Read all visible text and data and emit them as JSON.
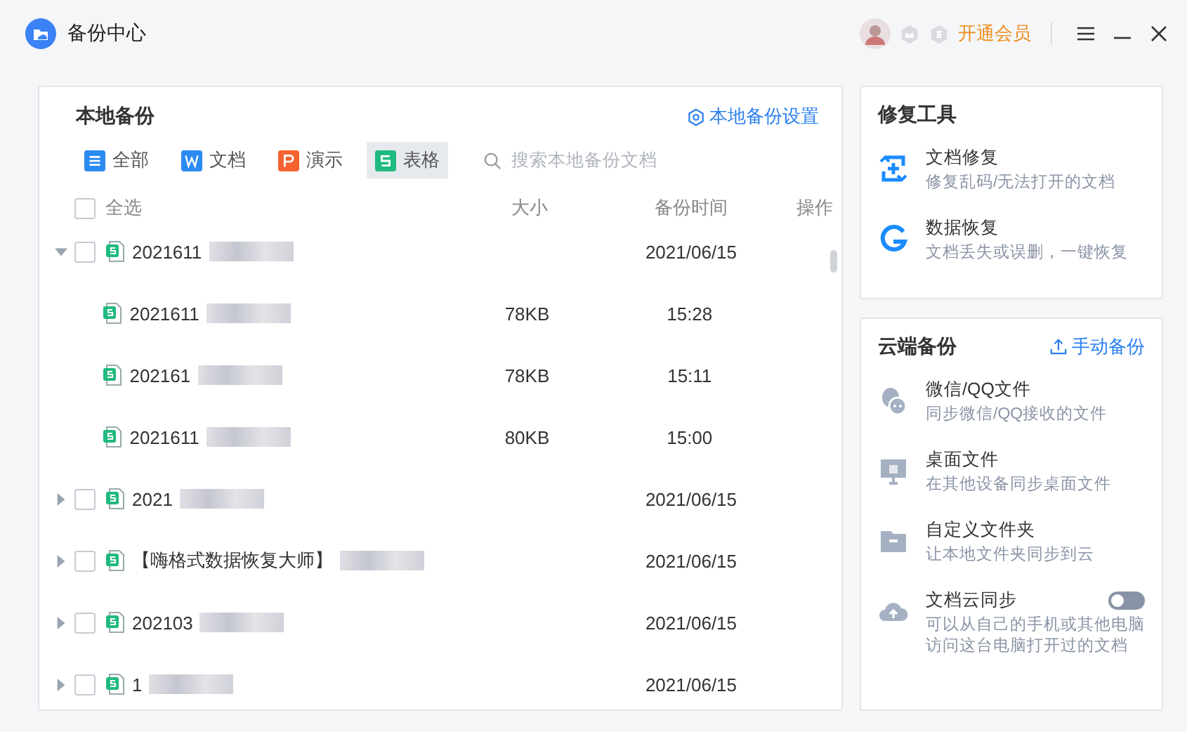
{
  "window": {
    "title": "备份中心",
    "vip_link": "开通会员"
  },
  "local_backup": {
    "title": "本地备份",
    "settings_link": "本地备份设置",
    "filters": [
      {
        "label": "全部",
        "kind": "all",
        "selected": false
      },
      {
        "label": "文档",
        "kind": "doc",
        "selected": false
      },
      {
        "label": "演示",
        "kind": "ppt",
        "selected": false
      },
      {
        "label": "表格",
        "kind": "sheet",
        "selected": true
      }
    ],
    "search": {
      "placeholder": "搜索本地备份文档"
    },
    "table": {
      "select_all": {
        "label": "全选",
        "checked": false
      },
      "columns": [
        "大小",
        "备份时间",
        "操作"
      ],
      "rows": [
        {
          "name": "2021611",
          "expanded": true,
          "checked": false,
          "time": "2021/06/15",
          "children": [
            {
              "name": "2021611",
              "size": "78KB",
              "time": "15:28"
            },
            {
              "name": "202161",
              "size": "78KB",
              "time": "15:11"
            },
            {
              "name": "2021611",
              "size": "80KB",
              "time": "15:00"
            }
          ]
        },
        {
          "name": "2021",
          "expanded": false,
          "checked": false,
          "time": "2021/06/15"
        },
        {
          "name": "【嗨格式数据恢复大师】",
          "expanded": false,
          "checked": false,
          "time": "2021/06/15"
        },
        {
          "name": "202103",
          "expanded": false,
          "checked": false,
          "time": "2021/06/15"
        },
        {
          "name": "1",
          "expanded": false,
          "checked": false,
          "time": "2021/06/15"
        }
      ]
    }
  },
  "repair_tools": {
    "title": "修复工具",
    "items": [
      {
        "kind": "doc-repair",
        "title": "文档修复",
        "desc": "修复乱码/无法打开的文档"
      },
      {
        "kind": "data-recovery",
        "title": "数据恢复",
        "desc": "文档丢失或误删，一键恢复"
      }
    ]
  },
  "cloud_backup": {
    "title": "云端备份",
    "action": "手动备份",
    "items": [
      {
        "kind": "chat",
        "title": "微信/QQ文件",
        "desc": "同步微信/QQ接收的文件"
      },
      {
        "kind": "desktop",
        "title": "桌面文件",
        "desc": "在其他设备同步桌面文件"
      },
      {
        "kind": "folder",
        "title": "自定义文件夹",
        "desc": "让本地文件夹同步到云"
      },
      {
        "kind": "cloud",
        "title": "文档云同步",
        "desc": "可以从自己的手机或其他电脑访问这台电脑打开过的文档",
        "on": false
      }
    ]
  }
}
